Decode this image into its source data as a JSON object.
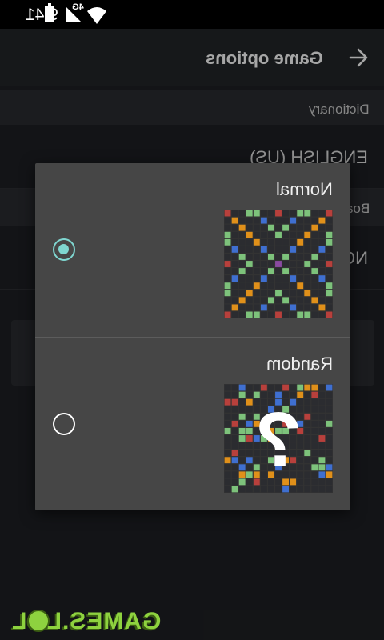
{
  "status_bar": {
    "time": "9:41",
    "network": "4G"
  },
  "toolbar": {
    "title": "Game options"
  },
  "settings": {
    "dictionary_header": "Dictionary",
    "dictionary_value": "ENGLISH (US)",
    "board_header": "Boa",
    "board_value": "NO"
  },
  "dialog": {
    "options": [
      {
        "label": "Normal",
        "selected": true
      },
      {
        "label": "Random",
        "selected": false
      }
    ]
  },
  "watermark": {
    "text": "GAMES.LOL"
  },
  "colors": {
    "accent": "#7fd6d0",
    "tile_blue": "#3f6fd0",
    "tile_green": "#7dc27b",
    "tile_orange": "#e0901a",
    "tile_red": "#b8403c",
    "tile_purple": "#8a4aa0"
  }
}
